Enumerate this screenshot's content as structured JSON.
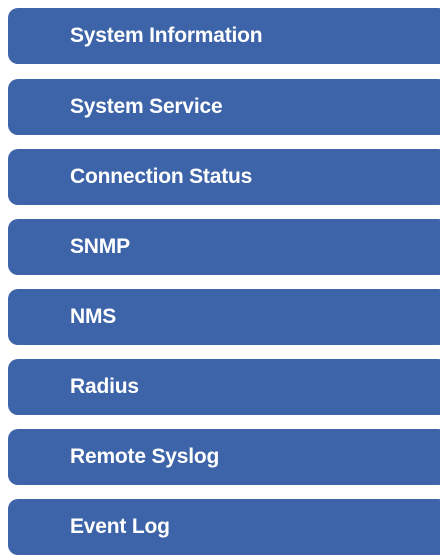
{
  "menu": {
    "items": [
      {
        "label": "System Information"
      },
      {
        "label": "System Service"
      },
      {
        "label": "Connection Status"
      },
      {
        "label": "SNMP"
      },
      {
        "label": "NMS"
      },
      {
        "label": "Radius"
      },
      {
        "label": "Remote Syslog"
      },
      {
        "label": "Event Log"
      }
    ],
    "item_color": "#3d64a8",
    "text_color": "#ffffff"
  }
}
